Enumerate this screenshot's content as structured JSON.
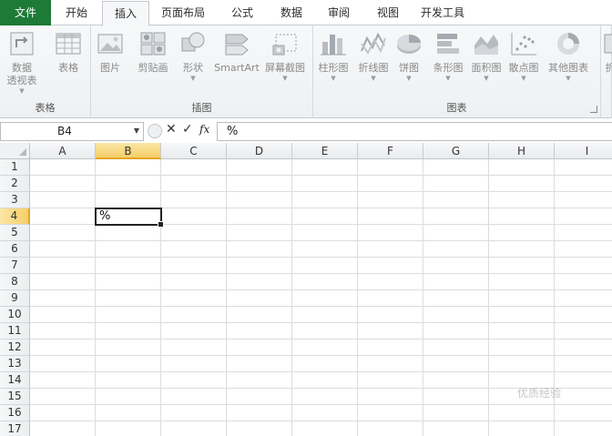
{
  "tabs": [
    {
      "label": "文件",
      "type": "file"
    },
    {
      "label": "开始",
      "type": "normal"
    },
    {
      "label": "插入",
      "type": "active"
    },
    {
      "label": "页面布局",
      "type": "normal"
    },
    {
      "label": "公式",
      "type": "normal"
    },
    {
      "label": "数据",
      "type": "normal"
    },
    {
      "label": "审阅",
      "type": "normal"
    },
    {
      "label": "视图",
      "type": "normal"
    },
    {
      "label": "开发工具",
      "type": "normal"
    }
  ],
  "ribbon": {
    "groups": [
      {
        "label": "表格",
        "buttons": [
          {
            "label": "数据",
            "label2": "透视表",
            "arrow": true,
            "icon": "pivot-table-icon"
          },
          {
            "label": "表格",
            "arrow": false,
            "icon": "table-icon"
          }
        ]
      },
      {
        "label": "插图",
        "buttons": [
          {
            "label": "图片",
            "arrow": false,
            "icon": "picture-icon"
          },
          {
            "label": "剪贴画",
            "arrow": false,
            "icon": "clip-art-icon"
          },
          {
            "label": "形状",
            "arrow": true,
            "icon": "shapes-icon"
          },
          {
            "label": "SmartArt",
            "arrow": false,
            "icon": "smartart-icon"
          },
          {
            "label": "屏幕截图",
            "arrow": true,
            "icon": "screenshot-icon"
          }
        ]
      },
      {
        "label": "图表",
        "buttons": [
          {
            "label": "柱形图",
            "arrow": true,
            "icon": "column-chart-icon"
          },
          {
            "label": "折线图",
            "arrow": true,
            "icon": "line-chart-icon"
          },
          {
            "label": "饼图",
            "arrow": true,
            "icon": "pie-chart-icon"
          },
          {
            "label": "条形图",
            "arrow": true,
            "icon": "bar-chart-icon"
          },
          {
            "label": "面积图",
            "arrow": true,
            "icon": "area-chart-icon"
          },
          {
            "label": "散点图",
            "arrow": true,
            "icon": "scatter-chart-icon"
          },
          {
            "label": "其他图表",
            "arrow": true,
            "icon": "other-charts-icon"
          }
        ]
      },
      {
        "label": "",
        "buttons": [
          {
            "label": "折",
            "arrow": false,
            "icon": "sparkline-icon"
          }
        ]
      }
    ]
  },
  "formula_bar": {
    "name_box": "B4",
    "cancel_glyph": "✕",
    "enter_glyph": "✓",
    "fx_label": "fx",
    "content": "%"
  },
  "grid": {
    "columns": [
      "A",
      "B",
      "C",
      "D",
      "E",
      "F",
      "G",
      "H",
      "I"
    ],
    "rows": [
      "1",
      "2",
      "3",
      "4",
      "5",
      "6",
      "7",
      "8",
      "9",
      "10",
      "11",
      "12",
      "13",
      "14",
      "15",
      "16",
      "17"
    ],
    "selected_column": "B",
    "selected_row": "4",
    "cells": {
      "B4": "%"
    }
  },
  "watermark": "优质经验"
}
